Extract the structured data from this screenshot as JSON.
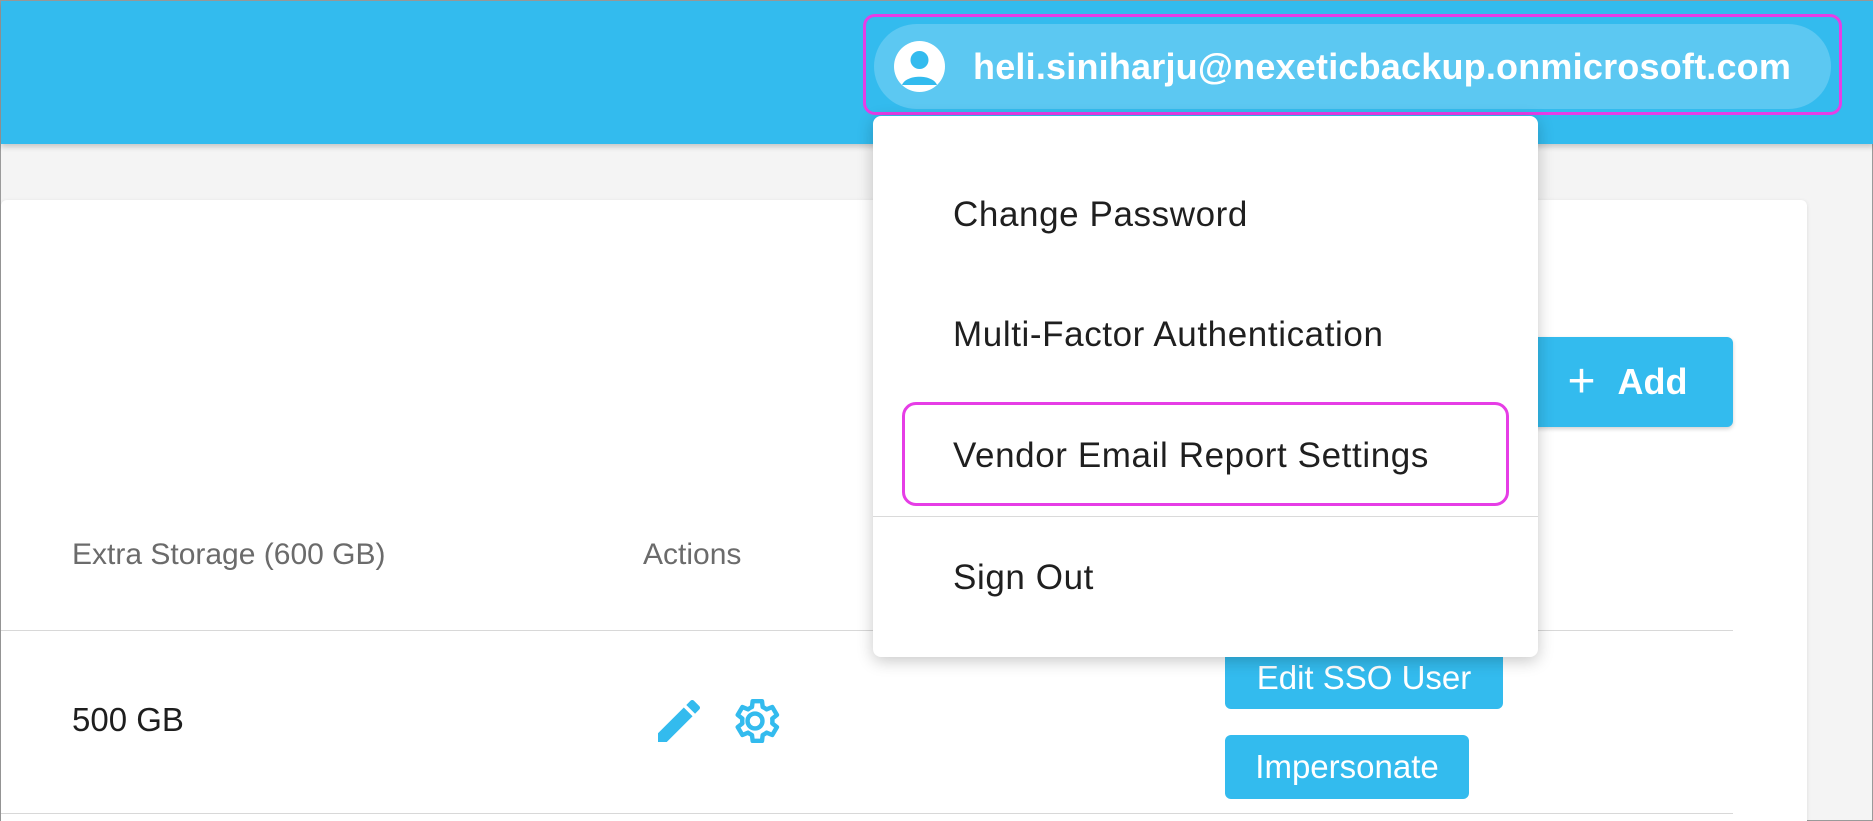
{
  "header": {
    "user_email": "heli.siniharju@nexeticbackup.onmicrosoft.com",
    "user_icon": "account-circle-icon"
  },
  "user_menu": {
    "items": [
      {
        "label": "Change Password"
      },
      {
        "label": "Multi-Factor Authentication"
      },
      {
        "label": "Vendor Email Report Settings"
      },
      {
        "label": "Sign Out"
      }
    ]
  },
  "toolbar": {
    "add_label": "Add",
    "add_icon": "plus-icon"
  },
  "table": {
    "columns": [
      "Extra Storage (600 GB)",
      "Actions"
    ],
    "rows": [
      {
        "extra_storage": "500 GB",
        "action_icons": [
          "pencil-icon",
          "gear-icon"
        ],
        "buttons": [
          "Edit SSO User",
          "Impersonate"
        ]
      }
    ]
  },
  "colors": {
    "accent": "#33bbee",
    "highlight": "#e63de6"
  }
}
